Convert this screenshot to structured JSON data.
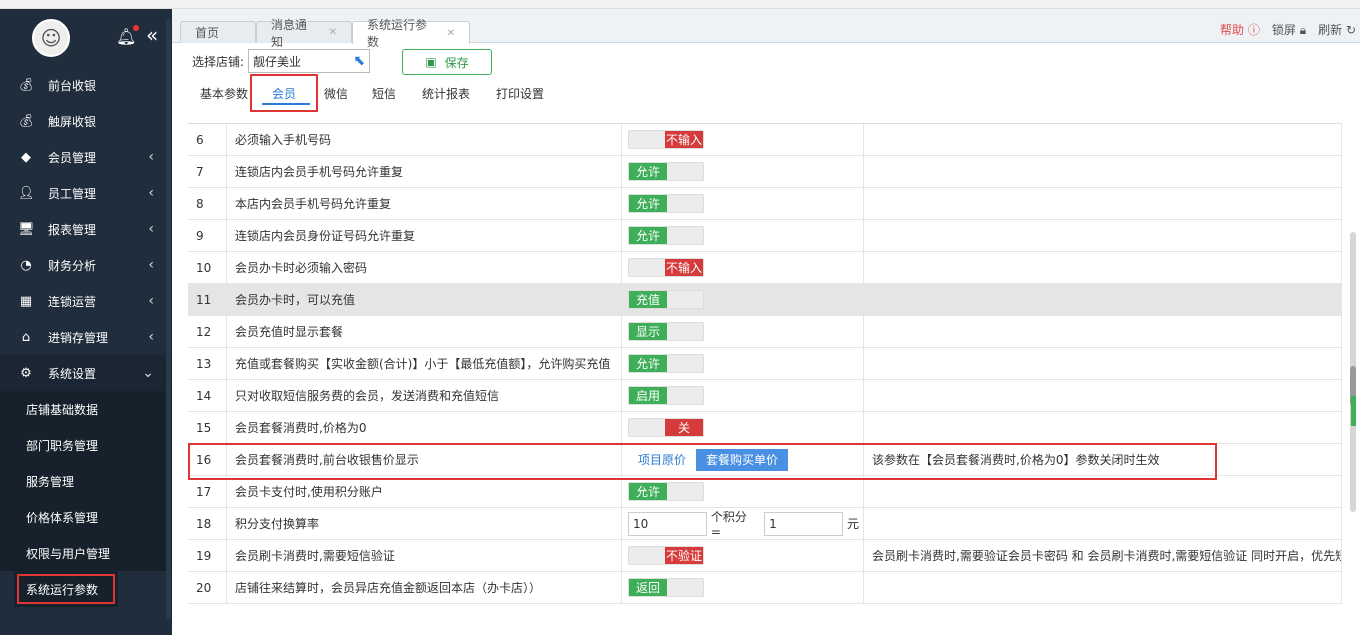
{
  "sidebar": {
    "bell_icon": "bell-icon",
    "menu": [
      {
        "label": "前台收银",
        "icon": "money-bag-icon",
        "arrow": ""
      },
      {
        "label": "触屏收银",
        "icon": "money-bag-icon",
        "arrow": ""
      },
      {
        "label": "会员管理",
        "icon": "diamond-icon",
        "arrow": "‹"
      },
      {
        "label": "员工管理",
        "icon": "user-icon",
        "arrow": "‹"
      },
      {
        "label": "报表管理",
        "icon": "monitor-icon",
        "arrow": "‹"
      },
      {
        "label": "财务分析",
        "icon": "pie-chart-icon",
        "arrow": "‹"
      },
      {
        "label": "连锁运营",
        "icon": "building-icon",
        "arrow": "‹"
      },
      {
        "label": "进销存管理",
        "icon": "home-icon",
        "arrow": "‹"
      },
      {
        "label": "系统设置",
        "icon": "gear-icon",
        "arrow": "⌄"
      }
    ],
    "submenu": [
      "店铺基础数据",
      "部门职务管理",
      "服务管理",
      "价格体系管理",
      "权限与用户管理",
      "系统运行参数"
    ]
  },
  "tabs": [
    {
      "label": "首页"
    },
    {
      "label": "消息通知"
    },
    {
      "label": "系统运行参数"
    }
  ],
  "tools": {
    "help": "帮助",
    "lock": "锁屏",
    "refresh": "刷新"
  },
  "store": {
    "label": "选择店铺:",
    "value": "靓仔美业",
    "save": "保存"
  },
  "subtabs": [
    "基本参数",
    "会员",
    "微信",
    "短信",
    "统计报表",
    "打印设置"
  ],
  "rows": [
    {
      "no": "6",
      "name": "必须输入手机号码",
      "on": "",
      "off": "不输入",
      "note": ""
    },
    {
      "no": "7",
      "name": "连锁店内会员手机号码允许重复",
      "on": "允许",
      "off": "",
      "note": ""
    },
    {
      "no": "8",
      "name": "本店内会员手机号码允许重复",
      "on": "允许",
      "off": "",
      "note": ""
    },
    {
      "no": "9",
      "name": "连锁店内会员身份证号码允许重复",
      "on": "允许",
      "off": "",
      "note": ""
    },
    {
      "no": "10",
      "name": "会员办卡时必须输入密码",
      "on": "",
      "off": "不输入",
      "note": ""
    },
    {
      "no": "11",
      "name": "会员办卡时，可以充值",
      "on": "充值",
      "off": "",
      "note": ""
    },
    {
      "no": "12",
      "name": "会员充值时显示套餐",
      "on": "显示",
      "off": "",
      "note": ""
    },
    {
      "no": "13",
      "name": "充值或套餐购买【实收金额(合计)】小于【最低充值额】，允许购买充值",
      "on": "允许",
      "off": "",
      "note": ""
    },
    {
      "no": "14",
      "name": "只对收取短信服务费的会员，发送消费和充值短信",
      "on": "启用",
      "off": "",
      "note": ""
    },
    {
      "no": "15",
      "name": "会员套餐消费时,价格为0",
      "on": "",
      "off": "关",
      "note": ""
    },
    {
      "no": "16",
      "name": "会员套餐消费时,前台收银售价显示",
      "seg_a": "项目原价",
      "seg_b": "套餐购买单价",
      "note": "该参数在【会员套餐消费时,价格为0】参数关闭时生效"
    },
    {
      "no": "17",
      "name": "会员卡支付时,使用积分账户",
      "on": "允许",
      "off": "",
      "note": ""
    },
    {
      "no": "18",
      "name": "积分支付换算率",
      "num1": "10",
      "mid": "个积分 =",
      "num2": "1",
      "unit": "元",
      "note": ""
    },
    {
      "no": "19",
      "name": "会员刷卡消费时,需要短信验证",
      "on": "",
      "off": "不验证",
      "note": "会员刷卡消费时,需要验证会员卡密码 和 会员刷卡消费时,需要短信验证 同时开启，优先短"
    },
    {
      "no": "20",
      "name": "店铺往来结算时，会员异店充值金额返回本店（办卡店））",
      "on": "返回",
      "off": "",
      "note": ""
    }
  ]
}
